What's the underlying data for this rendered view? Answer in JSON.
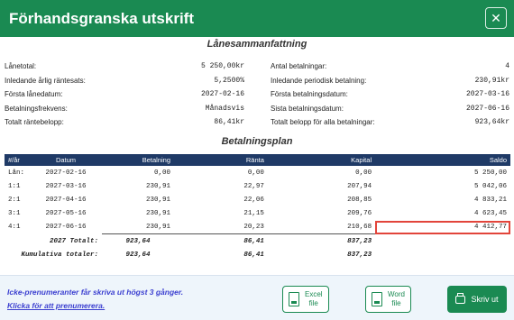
{
  "dialog": {
    "title": "Förhandsgranska utskrift",
    "close_symbol": "✕"
  },
  "summary": {
    "title": "Lånesammanfattning",
    "left": [
      {
        "label": "Lånetotal:",
        "value": "5 250,00kr"
      },
      {
        "label": "Inledande årlig räntesats:",
        "value": "5,2500%"
      },
      {
        "label": "Första lånedatum:",
        "value": "2027-02-16"
      },
      {
        "label": "Betalningsfrekvens:",
        "value": "Månadsvis"
      },
      {
        "label": "Totalt räntebelopp:",
        "value": "86,41kr"
      }
    ],
    "right": [
      {
        "label": "Antal betalningar:",
        "value": "4"
      },
      {
        "label": "Inledande periodisk betalning:",
        "value": "230,91kr"
      },
      {
        "label": "Första betalningsdatum:",
        "value": "2027-03-16"
      },
      {
        "label": "Sista betalningsdatum:",
        "value": "2027-06-16"
      },
      {
        "label": "Totalt belopp för alla betalningar:",
        "value": "923,64kr"
      }
    ]
  },
  "plan": {
    "title": "Betalningsplan",
    "headers": [
      "#/år",
      "Datum",
      "Betalning",
      "Ränta",
      "Kapital",
      "Saldo"
    ],
    "rows": [
      [
        "Lån:",
        "2027-02-16",
        "0,00",
        "0,00",
        "0,00",
        "5 250,00"
      ],
      [
        "1:1",
        "2027-03-16",
        "230,91",
        "22,97",
        "207,94",
        "5 042,06"
      ],
      [
        "2:1",
        "2027-04-16",
        "230,91",
        "22,06",
        "208,85",
        "4 833,21"
      ],
      [
        "3:1",
        "2027-05-16",
        "230,91",
        "21,15",
        "209,76",
        "4 623,45"
      ],
      [
        "4:1",
        "2027-06-16",
        "230,91",
        "20,23",
        "210,68",
        "4 412,77"
      ]
    ],
    "totals": [
      {
        "label": "2027 Totalt:",
        "payment": "923,64",
        "interest": "86,41",
        "principal": "837,23"
      },
      {
        "label": "Kumulativa totaler:",
        "payment": "923,64",
        "interest": "86,41",
        "principal": "837,23"
      }
    ]
  },
  "footer": {
    "notice": "Icke-prenumeranter får skriva ut högst 3 gånger.",
    "subscribe_link": "Klicka för att prenumerera.",
    "excel_button": {
      "line1": "Excel",
      "line2": "file",
      "icon_text": "XLSX"
    },
    "word_button": {
      "line1": "Word",
      "line2": "file",
      "icon_text": "DOCX"
    },
    "print_button": "Skriv ut"
  },
  "colors": {
    "brand_green": "#1a8a52",
    "table_header": "#1f3a66",
    "link": "#3b3fd0",
    "highlight": "#e2453b"
  }
}
